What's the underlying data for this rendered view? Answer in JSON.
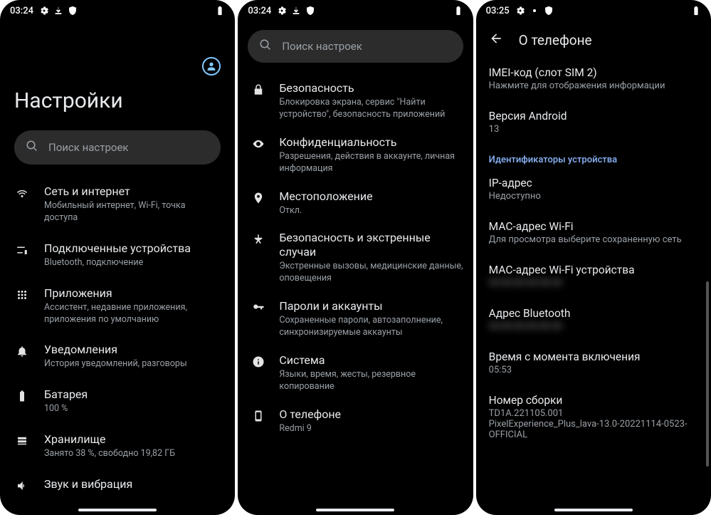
{
  "statusbars": {
    "p1": {
      "time": "03:24"
    },
    "p2": {
      "time": "03:24"
    },
    "p3": {
      "time": "03:25"
    }
  },
  "panel1": {
    "title": "Настройки",
    "search_placeholder": "Поиск настроек",
    "items": [
      {
        "title": "Сеть и интернет",
        "sub": "Мобильный интернет, Wi-Fi, точка доступа"
      },
      {
        "title": "Подключенные устройства",
        "sub": "Bluetooth, подключение"
      },
      {
        "title": "Приложения",
        "sub": "Ассистент, недавние приложения, приложения по умолчанию"
      },
      {
        "title": "Уведомления",
        "sub": "История уведомлений, разговоры"
      },
      {
        "title": "Батарея",
        "sub": "100 %"
      },
      {
        "title": "Хранилище",
        "sub": "Занято 38 %, свободно 19,82 ГБ"
      },
      {
        "title": "Звук и вибрация",
        "sub": ""
      }
    ]
  },
  "panel2": {
    "search_placeholder": "Поиск настроек",
    "items": [
      {
        "title": "Безопасность",
        "sub": "Блокировка экрана, сервис \"Найти устройство\", безопасность приложений"
      },
      {
        "title": "Конфиденциальность",
        "sub": "Разрешения, действия в аккаунте, личная информация"
      },
      {
        "title": "Местоположение",
        "sub": "Откл."
      },
      {
        "title": "Безопасность и экстренные случаи",
        "sub": "Экстренные вызовы, медицинские данные, оповещения"
      },
      {
        "title": "Пароли и аккаунты",
        "sub": "Сохраненные пароли, автозаполнение, синхронизируемые аккаунты"
      },
      {
        "title": "Система",
        "sub": "Языки, время, жесты, резервное копирование"
      },
      {
        "title": "О телефоне",
        "sub": "Redmi 9"
      }
    ]
  },
  "panel3": {
    "header": "О телефоне",
    "section_header": "Идентификаторы устройства",
    "items_top": [
      {
        "title": "IMEI-код (слот SIM 2)",
        "sub": "Нажмите для отображения информации"
      },
      {
        "title": "Версия Android",
        "sub": "13"
      }
    ],
    "items_ids": [
      {
        "title": "IP-адрес",
        "sub": "Недоступно",
        "blur": false
      },
      {
        "title": "MAC-адрес Wi-Fi",
        "sub": "Для просмотра выберите сохраненную сеть",
        "blur": false
      },
      {
        "title": "MAC-адрес Wi-Fi устройства",
        "sub": "00:00:00:00:00:00",
        "blur": true
      },
      {
        "title": "Адрес Bluetooth",
        "sub": "00:00:00:00:00:00",
        "blur": true
      },
      {
        "title": "Время с момента включения",
        "sub": "05:53",
        "blur": false
      },
      {
        "title": "Номер сборки",
        "sub": "TD1A.221105.001\nPixelExperience_Plus_lava-13.0-20221114-0523-OFFICIAL",
        "blur": false
      }
    ]
  }
}
